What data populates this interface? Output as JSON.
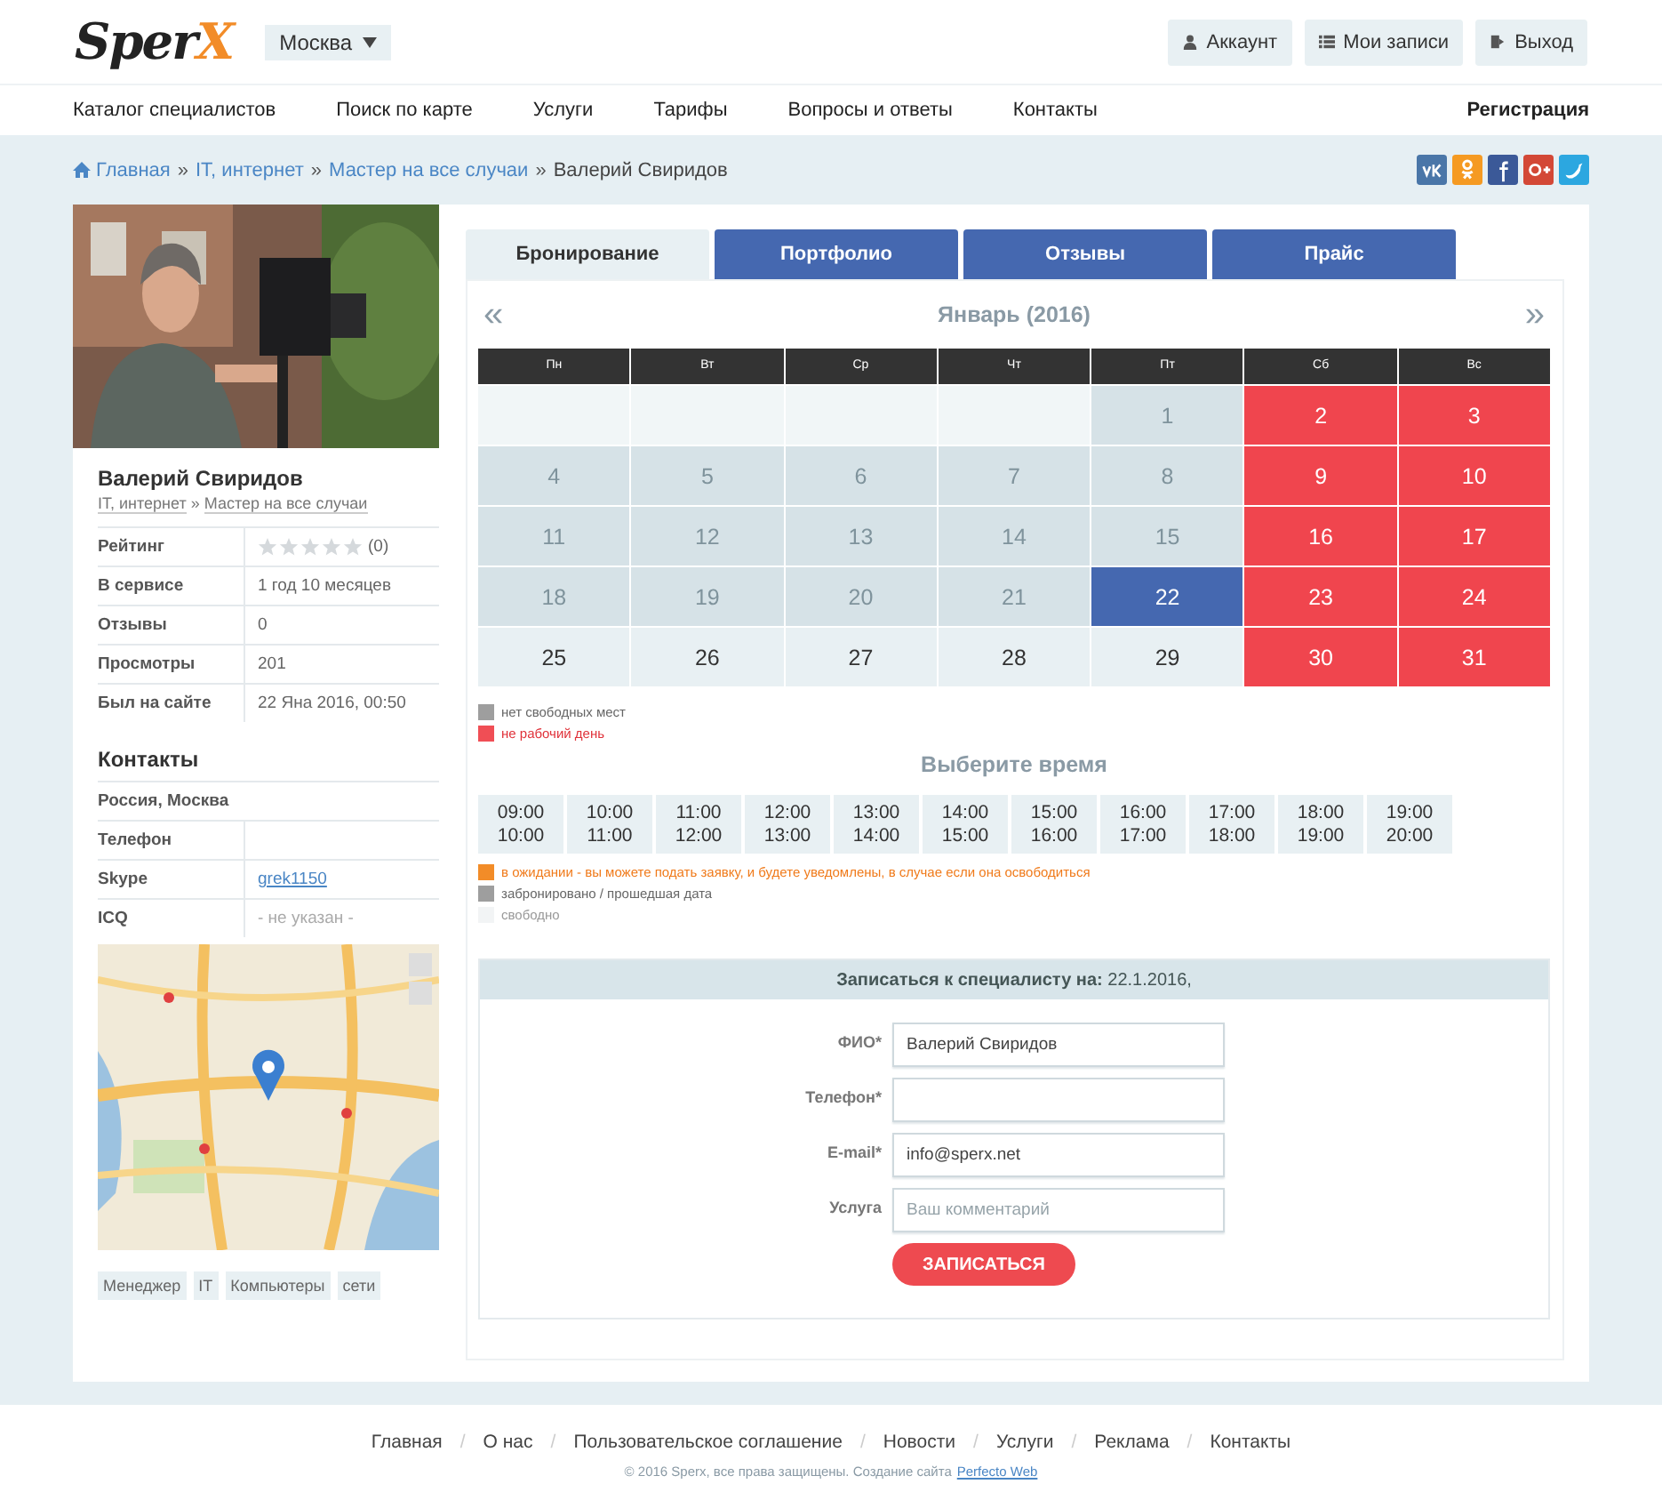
{
  "header": {
    "logo": {
      "text": "Sper",
      "accent": "X"
    },
    "city": "Москва",
    "buttons": [
      {
        "kind": "account",
        "label": "Аккаунт"
      },
      {
        "kind": "list",
        "label": "Мои записи"
      },
      {
        "kind": "exit",
        "label": "Выход"
      }
    ]
  },
  "nav": {
    "items": [
      "Каталог специалистов",
      "Поиск по карте",
      "Услуги",
      "Тарифы",
      "Вопросы и ответы",
      "Контакты"
    ],
    "register": "Регистрация"
  },
  "breadcrumb": {
    "links": [
      "Главная",
      "IT, интернет",
      "Мастер на все случаи"
    ],
    "separator": "»",
    "current": "Валерий Свиридов"
  },
  "share": [
    {
      "kind": "vk",
      "color": "#4a76a8"
    },
    {
      "kind": "ok",
      "color": "#f59a22"
    },
    {
      "kind": "facebook",
      "color": "#3b5998"
    },
    {
      "kind": "google",
      "color": "#d34836"
    },
    {
      "kind": "twitter",
      "color": "#2ca7e0"
    }
  ],
  "profile": {
    "photo": {
      "kind": "picture"
    },
    "name": "Валерий Свиридов",
    "category": "IT, интернет",
    "category_sep": "»",
    "subcategory": "Мастер на все случаи",
    "stats": [
      {
        "kind": "rating",
        "label": "Рейтинг",
        "stars": 0,
        "value": "(0)"
      },
      {
        "kind": "text",
        "label": "В сервисе",
        "value": "1 год 10 месяцев"
      },
      {
        "kind": "text",
        "label": "Отзывы",
        "value": "0"
      },
      {
        "kind": "text",
        "label": "Просмотры",
        "value": "201"
      },
      {
        "kind": "text",
        "label": "Был на сайте",
        "value": "22 Яна 2016, 00:50"
      }
    ],
    "contacts_title": "Контакты",
    "contacts": [
      {
        "kind": "full",
        "label": "Россия, Москва"
      },
      {
        "kind": "text",
        "label": "Телефон"
      },
      {
        "kind": "link",
        "label": "Skype",
        "value": "grek1150"
      },
      {
        "kind": "muted",
        "label": "ICQ",
        "value": "- не указан -"
      }
    ],
    "map": {
      "kind": "picture"
    },
    "tags": [
      "Менеджер",
      "IT",
      "Компьютеры",
      "сети"
    ]
  },
  "tabs": [
    {
      "label": "Бронирование",
      "selected": true
    },
    {
      "label": "Портфолио",
      "selected": false
    },
    {
      "label": "Отзывы",
      "selected": false
    },
    {
      "label": "Прайс",
      "selected": false
    }
  ],
  "calendar": {
    "prev": "«",
    "title": "Январь (2016)",
    "next": "»",
    "weekdays": [
      "Пн",
      "Вт",
      "Ср",
      "Чт",
      "Пт",
      "Сб",
      "Вс"
    ],
    "weeks": [
      [
        {
          "kind": "blank"
        },
        {
          "kind": "blank"
        },
        {
          "kind": "blank"
        },
        {
          "kind": "blank"
        },
        {
          "kind": "past",
          "day": "1"
        },
        {
          "kind": "off",
          "day": "2"
        },
        {
          "kind": "off",
          "day": "3"
        }
      ],
      [
        {
          "kind": "past",
          "day": "4"
        },
        {
          "kind": "past",
          "day": "5"
        },
        {
          "kind": "past",
          "day": "6"
        },
        {
          "kind": "past",
          "day": "7"
        },
        {
          "kind": "past",
          "day": "8"
        },
        {
          "kind": "off",
          "day": "9"
        },
        {
          "kind": "off",
          "day": "10"
        }
      ],
      [
        {
          "kind": "past",
          "day": "11"
        },
        {
          "kind": "past",
          "day": "12"
        },
        {
          "kind": "past",
          "day": "13"
        },
        {
          "kind": "past",
          "day": "14"
        },
        {
          "kind": "past",
          "day": "15"
        },
        {
          "kind": "off",
          "day": "16"
        },
        {
          "kind": "off",
          "day": "17"
        }
      ],
      [
        {
          "kind": "past",
          "day": "18"
        },
        {
          "kind": "past",
          "day": "19"
        },
        {
          "kind": "past",
          "day": "20"
        },
        {
          "kind": "past",
          "day": "21"
        },
        {
          "kind": "selected",
          "day": "22"
        },
        {
          "kind": "off",
          "day": "23"
        },
        {
          "kind": "off",
          "day": "24"
        }
      ],
      [
        {
          "kind": "free",
          "day": "25"
        },
        {
          "kind": "free",
          "day": "26"
        },
        {
          "kind": "free",
          "day": "27"
        },
        {
          "kind": "free",
          "day": "28"
        },
        {
          "kind": "free",
          "day": "29"
        },
        {
          "kind": "off",
          "day": "30"
        },
        {
          "kind": "off",
          "day": "31"
        }
      ]
    ]
  },
  "day_legend": [
    {
      "color": "#9e9e9e",
      "label": "нет свободных мест",
      "kind": "plain"
    },
    {
      "color": "#f04e55",
      "label": "не рабочий день",
      "kind": "alert"
    }
  ],
  "time_title": "Выберите время",
  "slots": [
    {
      "from": "09:00",
      "to": "10:00"
    },
    {
      "from": "10:00",
      "to": "11:00"
    },
    {
      "from": "11:00",
      "to": "12:00"
    },
    {
      "from": "12:00",
      "to": "13:00"
    },
    {
      "from": "13:00",
      "to": "14:00"
    },
    {
      "from": "14:00",
      "to": "15:00"
    },
    {
      "from": "15:00",
      "to": "16:00"
    },
    {
      "from": "16:00",
      "to": "17:00"
    },
    {
      "from": "17:00",
      "to": "18:00"
    },
    {
      "from": "18:00",
      "to": "19:00"
    },
    {
      "from": "19:00",
      "to": "20:00"
    }
  ],
  "time_legend": [
    {
      "color": "#f28c28",
      "label": "в ожидании - вы можете подать заявку, и будете уведомлены, в случае если она освободиться",
      "kind": "warn"
    },
    {
      "color": "#9e9e9e",
      "label": "забронировано / прошедшая дата",
      "kind": "plain"
    },
    {
      "color": "#f2f4f5",
      "label": "свободно",
      "kind": "faint"
    }
  ],
  "booking": {
    "title": "**Записаться к специалисту на:** 22.1.2016,",
    "fields": [
      {
        "label": "ФИО*",
        "value": "Валерий Свиридов"
      },
      {
        "label": "Телефон*"
      },
      {
        "label": "E-mail*",
        "value": "info@sperx.net"
      },
      {
        "label": "Услуга",
        "placeholder": "Ваш комментарий"
      }
    ],
    "submit": "ЗАПИСАТЬСЯ"
  },
  "footer": {
    "links": [
      "Главная",
      "О нас",
      "Пользовательское соглашение",
      "Новости",
      "Услуги",
      "Реклама",
      "Контакты"
    ],
    "separator": "/",
    "copyright": "© 2016 Sperx, все права защищены. Создание сайта",
    "credit": "Perfecto Web"
  }
}
